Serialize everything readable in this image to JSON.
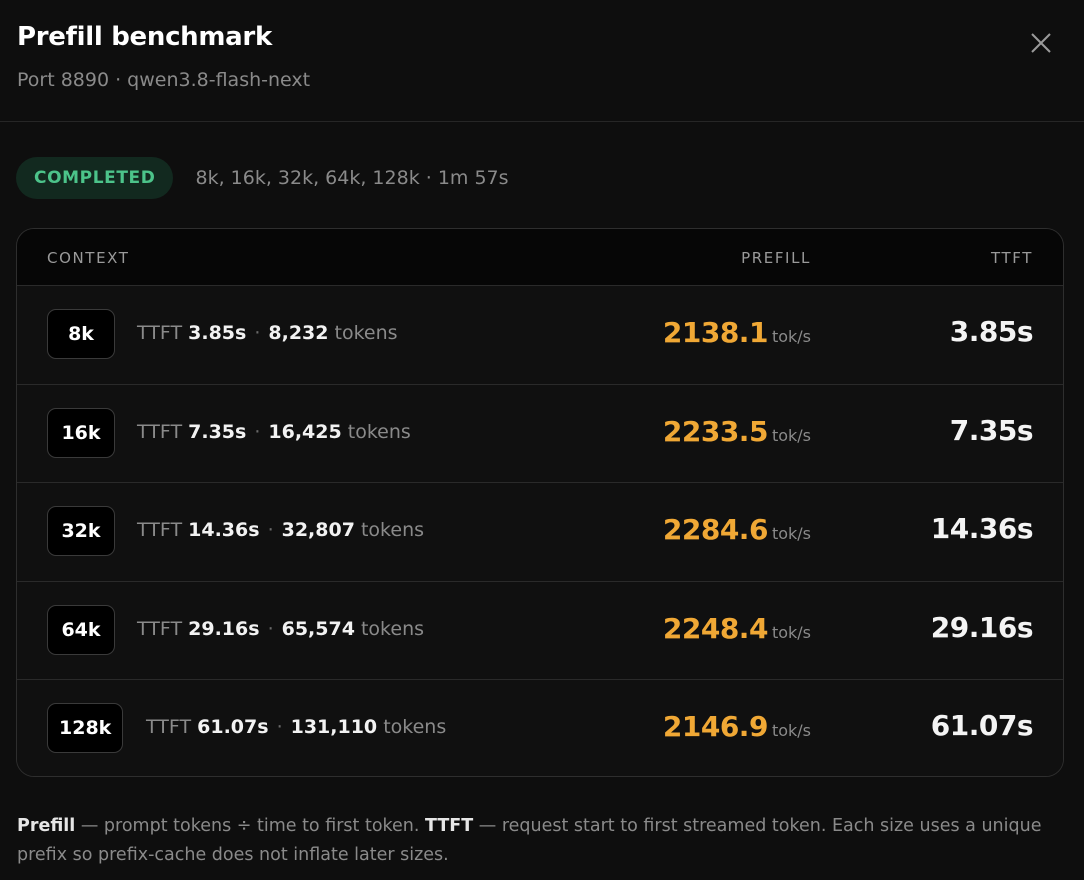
{
  "header": {
    "title": "Prefill benchmark",
    "subtitle": "Port 8890 · qwen3.8-flash-next",
    "close_icon": "close-icon"
  },
  "status": {
    "badge": "COMPLETED",
    "meta": "8k, 16k, 32k, 64k, 128k · 1m 57s",
    "badge_color": "#4cc38a"
  },
  "table": {
    "headers": {
      "context": "CONTEXT",
      "prefill": "PREFILL",
      "ttft": "TTFT"
    },
    "rows": [
      {
        "context": "8k",
        "ttft_label": "TTFT",
        "ttft_small": "3.85s",
        "dot": "·",
        "tokens": "8,232",
        "tokens_label": "tokens",
        "prefill": "2138.1",
        "prefill_unit": "tok/s",
        "ttft": "3.85s"
      },
      {
        "context": "16k",
        "ttft_label": "TTFT",
        "ttft_small": "7.35s",
        "dot": "·",
        "tokens": "16,425",
        "tokens_label": "tokens",
        "prefill": "2233.5",
        "prefill_unit": "tok/s",
        "ttft": "7.35s"
      },
      {
        "context": "32k",
        "ttft_label": "TTFT",
        "ttft_small": "14.36s",
        "dot": "·",
        "tokens": "32,807",
        "tokens_label": "tokens",
        "prefill": "2284.6",
        "prefill_unit": "tok/s",
        "ttft": "14.36s"
      },
      {
        "context": "64k",
        "ttft_label": "TTFT",
        "ttft_small": "29.16s",
        "dot": "·",
        "tokens": "65,574",
        "tokens_label": "tokens",
        "prefill": "2248.4",
        "prefill_unit": "tok/s",
        "ttft": "29.16s"
      },
      {
        "context": "128k",
        "ttft_label": "TTFT",
        "ttft_small": "61.07s",
        "dot": "·",
        "tokens": "131,110",
        "tokens_label": "tokens",
        "prefill": "2146.9",
        "prefill_unit": "tok/s",
        "ttft": "61.07s"
      }
    ]
  },
  "footnote": {
    "term1": "Prefill",
    "text1": " — prompt tokens ÷ time to first token. ",
    "term2": "TTFT",
    "text2": " — request start to first streamed token. Each size uses a unique prefix so prefix-cache does not inflate later sizes."
  },
  "colors": {
    "accent": "#f0a835",
    "success": "#4cc38a",
    "background": "#0e0e0e"
  }
}
